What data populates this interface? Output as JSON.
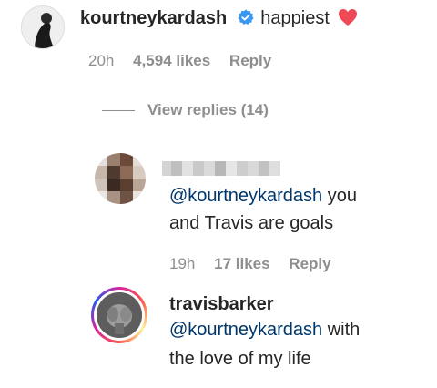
{
  "main_comment": {
    "username": "kourtneykardash",
    "verified_icon": "verified-badge-icon",
    "text": "happiest",
    "emoji_icon": "red-heart-icon",
    "time": "20h",
    "likes": "4,594 likes",
    "reply_label": "Reply",
    "view_replies": "View replies (14)"
  },
  "replies": [
    {
      "username_blurred": true,
      "mention": "@kourtneykardash",
      "text_line1_rest": " you",
      "text_line2": "and Travis are goals",
      "time": "19h",
      "likes": "17 likes",
      "reply_label": "Reply"
    },
    {
      "username": "travisbarker",
      "mention": "@kourtneykardash",
      "text_line1_rest": " with",
      "text_line2": "the love of my life",
      "story_ring": true
    }
  ],
  "colors": {
    "text": "#262626",
    "meta": "#8e8e8e",
    "mention": "#00376b",
    "verified": "#3897f0",
    "heart": "#ed4956"
  }
}
